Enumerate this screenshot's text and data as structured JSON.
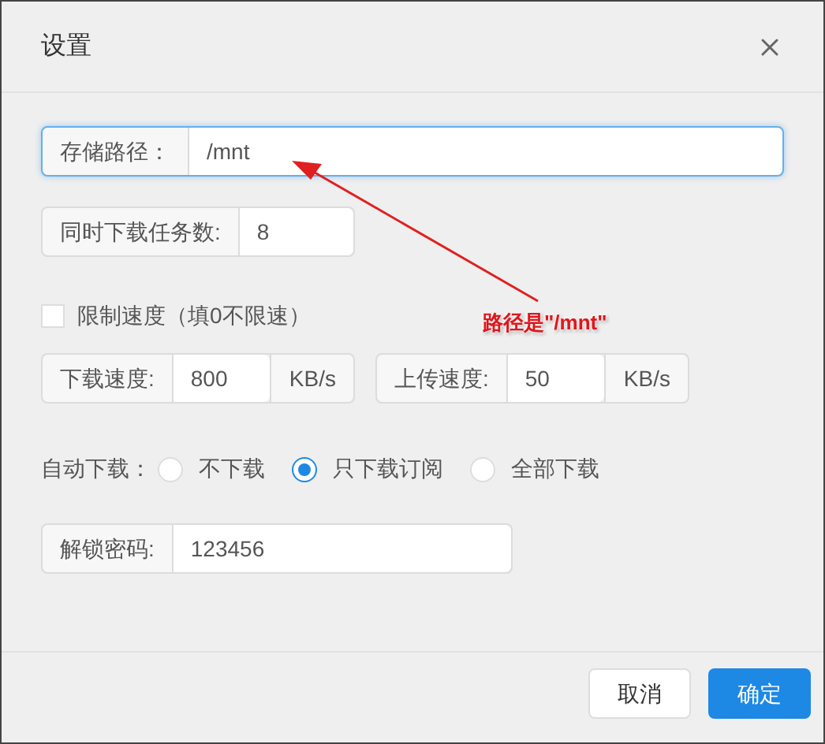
{
  "dialog": {
    "title": "设置"
  },
  "storage_path": {
    "label": "存储路径：",
    "value": "/mnt",
    "focused": true
  },
  "concurrent_tasks": {
    "label": "同时下载任务数:",
    "value": "8"
  },
  "limit_speed": {
    "label": "限制速度（填0不限速）",
    "checked": false
  },
  "speeds": [
    {
      "label": "下载速度:",
      "value": "800",
      "unit": "KB/s"
    },
    {
      "label": "上传速度:",
      "value": "50",
      "unit": "KB/s"
    }
  ],
  "auto_download": {
    "label": "自动下载：",
    "options": [
      {
        "label": "不下载",
        "selected": false
      },
      {
        "label": "只下载订阅",
        "selected": true
      },
      {
        "label": "全部下载",
        "selected": false
      }
    ]
  },
  "unlock_password": {
    "label": "解锁密码:",
    "value": "123456"
  },
  "buttons": [
    {
      "label": "取消",
      "kind": "secondary"
    },
    {
      "label": "确定",
      "kind": "primary"
    }
  ],
  "annotation": {
    "text": "路径是\"/mnt\""
  }
}
